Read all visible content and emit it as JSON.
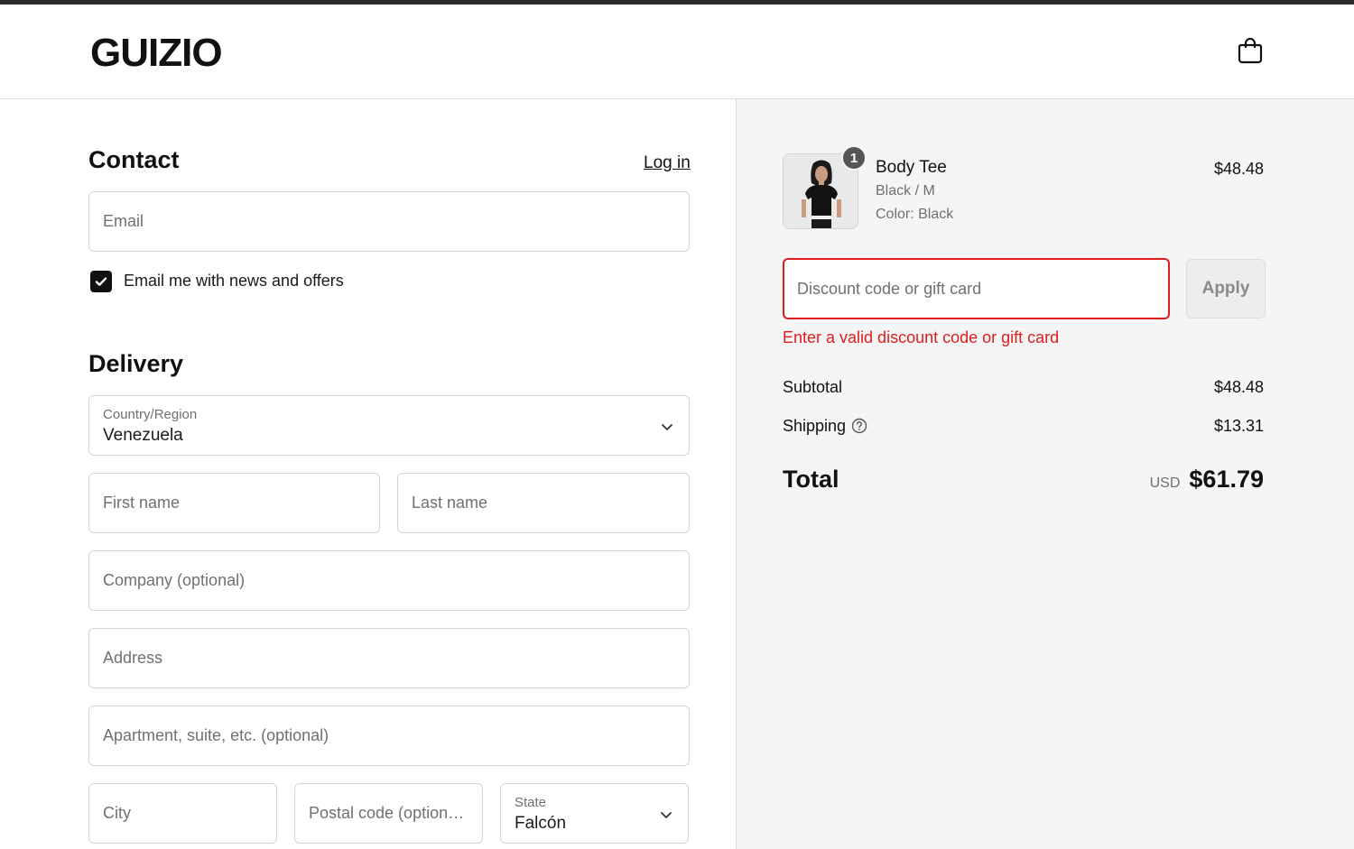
{
  "header": {
    "logo": "GUIZIO",
    "cart_icon": "shopping-bag-icon"
  },
  "contact": {
    "title": "Contact",
    "login_label": "Log in",
    "email_placeholder": "Email",
    "marketing_label": "Email me with news and offers",
    "marketing_checked": true
  },
  "delivery": {
    "title": "Delivery",
    "country_label": "Country/Region",
    "country_value": "Venezuela",
    "first_name_placeholder": "First name",
    "last_name_placeholder": "Last name",
    "company_placeholder": "Company (optional)",
    "address_placeholder": "Address",
    "apartment_placeholder": "Apartment, suite, etc. (optional)",
    "city_placeholder": "City",
    "postal_placeholder": "Postal code (option…",
    "state_label": "State",
    "state_value": "Falcón"
  },
  "summary": {
    "item": {
      "quantity": "1",
      "name": "Body Tee",
      "variant": "Black / M",
      "color": "Color: Black",
      "price": "$48.48"
    },
    "discount_placeholder": "Discount code or gift card",
    "apply_label": "Apply",
    "discount_error": "Enter a valid discount code or gift card",
    "subtotal_label": "Subtotal",
    "subtotal_value": "$48.48",
    "shipping_label": "Shipping",
    "shipping_value": "$13.31",
    "total_label": "Total",
    "currency": "USD",
    "total_value": "$61.79"
  },
  "colors": {
    "error": "#dd1d1d",
    "panel_bg": "#f5f5f5",
    "checkbox": "#111111"
  }
}
